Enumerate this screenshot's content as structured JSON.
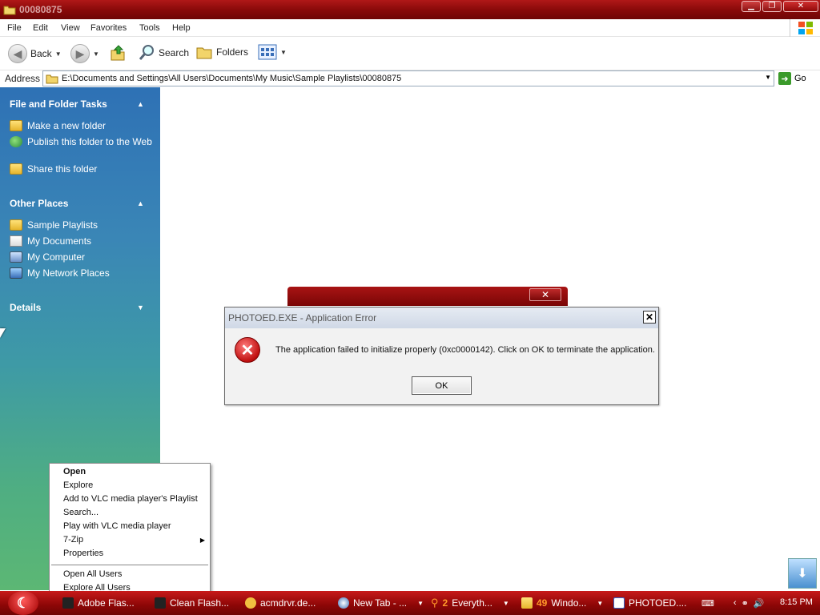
{
  "window": {
    "title": "00080875"
  },
  "menubar": {
    "items": [
      "File",
      "Edit",
      "View",
      "Favorites",
      "Tools",
      "Help"
    ]
  },
  "toolbar": {
    "back_label": "Back",
    "search_label": "Search",
    "folders_label": "Folders"
  },
  "address": {
    "label": "Address",
    "path": "E:\\Documents and Settings\\All Users\\Documents\\My Music\\Sample Playlists\\00080875",
    "go_label": "Go"
  },
  "sidebar": {
    "file_tasks": {
      "header": "File and Folder Tasks",
      "items": [
        "Make a new folder",
        "Publish this folder to the Web",
        "Share this folder"
      ]
    },
    "other_places": {
      "header": "Other Places",
      "items": [
        "Sample Playlists",
        "My Documents",
        "My Computer",
        "My Network Places"
      ]
    },
    "details": {
      "header": "Details"
    }
  },
  "dialog": {
    "title": "PHOTOED.EXE - Application Error",
    "message": "The application failed to initialize properly (0xc0000142). Click on OK to terminate the application.",
    "ok_label": "OK"
  },
  "context_menu": {
    "items": [
      "Open",
      "Explore",
      "Add to VLC media player's Playlist",
      "Search...",
      "Play with VLC media player",
      "7-Zip",
      "Properties"
    ],
    "items_after_separator": [
      "Open All Users",
      "Explore All Users"
    ]
  },
  "taskbar": {
    "items": [
      {
        "label": "Adobe Flas..."
      },
      {
        "label": "Clean Flash..."
      },
      {
        "label": "acmdrvr.de..."
      },
      {
        "label": "New Tab - ..."
      },
      {
        "count": "2",
        "label": "Everyth..."
      },
      {
        "count": "49",
        "label": "Windo..."
      },
      {
        "label": "PHOTOED...."
      }
    ],
    "clock": "8:15 PM"
  },
  "colors": {
    "titlebar": "#8a0a0a",
    "taskbar": "#a00808",
    "sidebar_top": "#2e71b5",
    "sidebar_bottom": "#5cb774"
  }
}
